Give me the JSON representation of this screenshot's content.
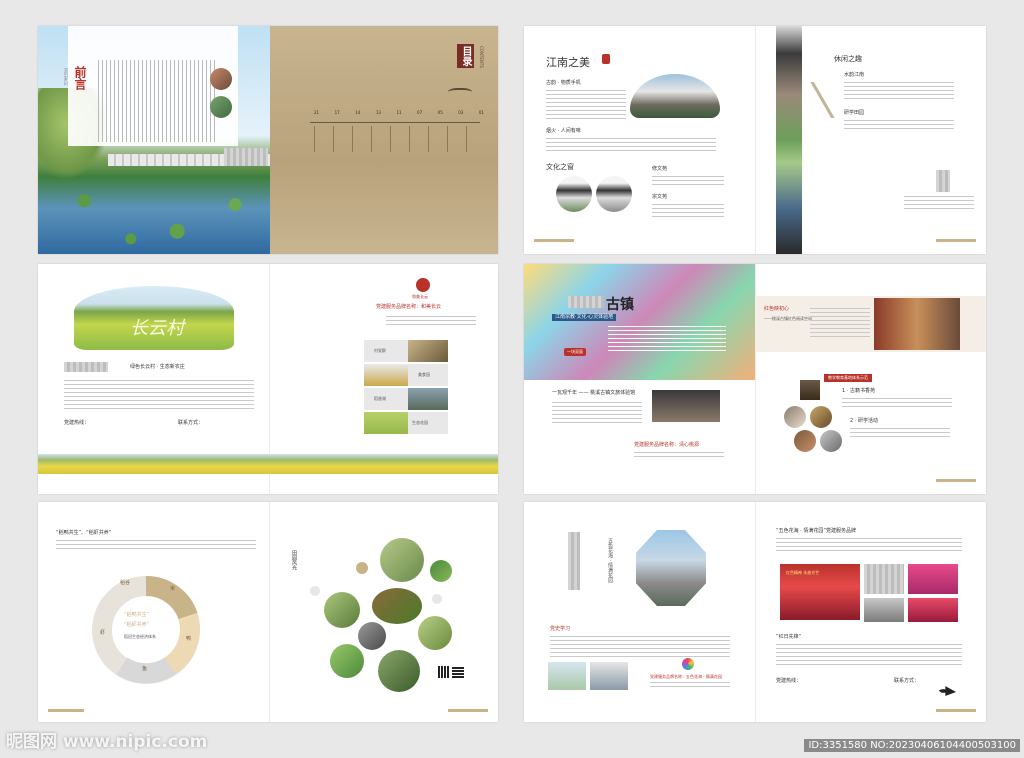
{
  "spreads": {
    "s1": {
      "preface_title": "前言",
      "preface_en": "PREFACE",
      "contents_title": "目录",
      "contents_en": "CONTENTS",
      "toc_numbers": [
        "21",
        "17",
        "14",
        "13",
        "11",
        "07",
        "05",
        "03",
        "01"
      ]
    },
    "s2": {
      "title_jiangnan": "江南之美",
      "item1": "古韵 · 物质手机",
      "item2": "烟火 · 人间有味",
      "title_culture": "文化之窗",
      "culture1": "修文苑",
      "culture2": "宗文苑",
      "title_leisure": "休闲之趣",
      "leisure1": "水韵江南",
      "leisure2": "研学田园"
    },
    "s3": {
      "village_caption": "绿色长云村 · 生态新农庄",
      "contact": "党建热线：",
      "contact2": "联系方式：",
      "right_heading": "党建服务品牌名称：和美长云",
      "brand": "和美长云",
      "panel_labels": [
        "村党群",
        "美食园",
        "稻香湖",
        "生态花园"
      ]
    },
    "s4": {
      "ancient_town": "古镇",
      "subtitle": "江南宗教·文化·心灵体验地",
      "tag": "一块双面",
      "right_title": "红色映初心",
      "right_subtitle": "——桃溪古镇红色阅读空间",
      "band": "教学教育基地体系示范",
      "sub_a": "1 · 古籍书香苑",
      "sub_b": "2 · 研学活动",
      "left_heading": "一瓦观千年 —— 桃溪古镇文旅体验馆",
      "bottom_caption": "党建服务品牌名称：清心桃源"
    },
    "s5": {
      "heading": "“稻鸭共生”、“稻虾共养”",
      "ring_labels": [
        "稻谷",
        "米",
        "鸭",
        "鱼",
        "虾"
      ],
      "ring_center1": "“稻鸭共生”",
      "ring_center2": "“稻虾共养”",
      "ring_center3": "稻田生态经济体系",
      "right_vertical": "田园风光"
    },
    "s6": {
      "vertical_text": "五色花海 · 情满花园",
      "section": "党史学习",
      "right_heading": "“五色花海 · 情满花园”党建服务品牌",
      "sub2": "“红日先锋”",
      "brand_caption": "党建服务品牌名称：五色花海 · 情满花园",
      "contact": "党建热线：",
      "contact2": "联系方式：",
      "stage_text": "红色精神 永放光芒"
    }
  },
  "watermark": "昵图网 www.nipic.com",
  "image_id": "ID:3351580 NO:20230406104400503100",
  "colors": {
    "accent_red": "#b8322a",
    "gold": "#c9b48a",
    "tan": "#b7a27c"
  }
}
